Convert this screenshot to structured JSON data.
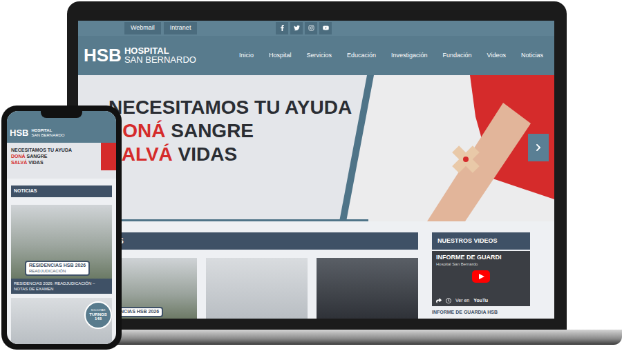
{
  "top_bar": {
    "links": [
      {
        "label": "Webmail"
      },
      {
        "label": "Intranet"
      }
    ]
  },
  "logo": {
    "mark": "HSB",
    "line1": "HOSPITAL",
    "line2": "SAN BERNARDO"
  },
  "nav": [
    {
      "label": "Inicio"
    },
    {
      "label": "Hospital"
    },
    {
      "label": "Servicios"
    },
    {
      "label": "Educación"
    },
    {
      "label": "Investigación"
    },
    {
      "label": "Fundación"
    },
    {
      "label": "Videos"
    },
    {
      "label": "Noticias"
    }
  ],
  "banner": {
    "line1": "NECESITAMOS TU AYUDA",
    "line2_accent": "DONÁ",
    "line2": "SANGRE",
    "line3_accent": "SALVÁ",
    "line3": "VIDAS"
  },
  "news": {
    "title": "NOTICIAS",
    "badge_title": "RESIDENCIAS HSB 2026",
    "badge_subtitle": "READJUDICACIÓN",
    "caption": "RESIDENCIAS 2026: READJUDICACIÓN – NOTAS DE EXAMEN"
  },
  "videos": {
    "title": "NUESTROS VIDEOS",
    "video_title": "INFORME DE GUARDI",
    "channel": "Hospital San Bernardo",
    "watch": "Ver en",
    "brand": "YouTu",
    "caption": "INFORME DE GUARDIA HSB"
  },
  "turnos": {
    "line1": "SOLICITAR",
    "line2": "TURNOS",
    "line3": "148"
  }
}
